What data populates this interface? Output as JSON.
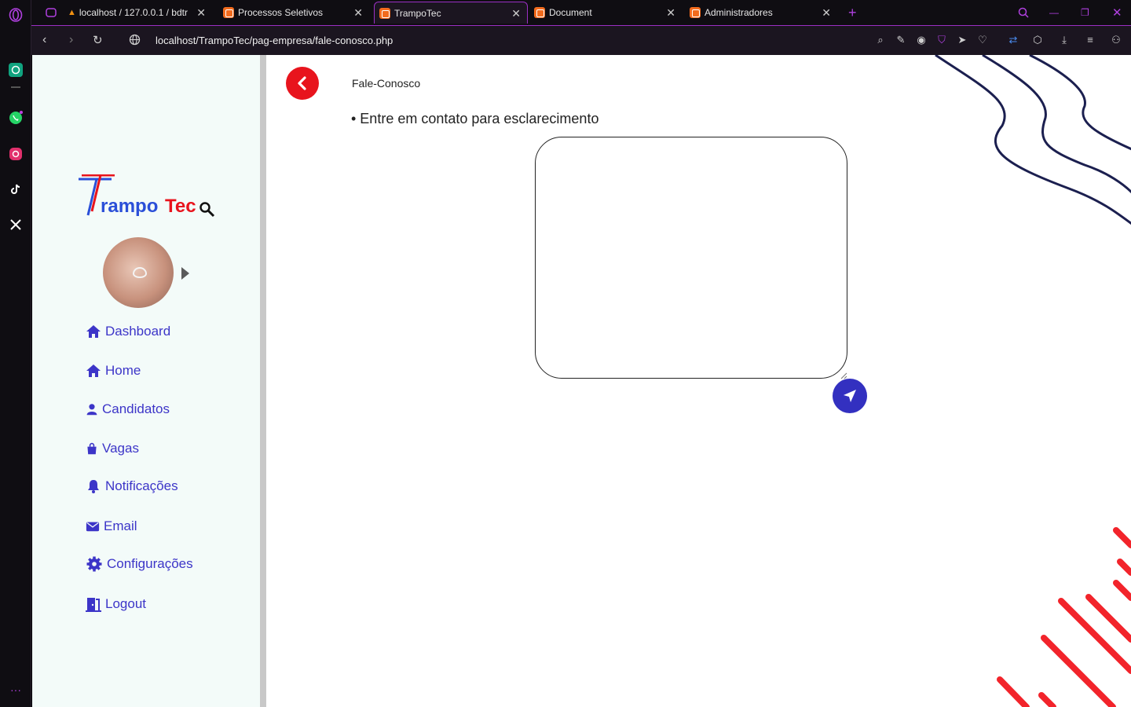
{
  "browser": {
    "tabs": [
      {
        "label": "localhost / 127.0.0.1 / bdtr"
      },
      {
        "label": "Processos Seletivos"
      },
      {
        "label": "TrampoTec"
      },
      {
        "label": "Document"
      },
      {
        "label": "Administradores"
      }
    ],
    "url": "localhost/TrampoTec/pag-empresa/fale-conosco.php"
  },
  "sidebar": {
    "logo_text": "TrampoTec",
    "items": [
      {
        "label": "Dashboard",
        "icon": "home-icon"
      },
      {
        "label": "Home",
        "icon": "home-icon"
      },
      {
        "label": "Candidatos",
        "icon": "user-icon"
      },
      {
        "label": "Vagas",
        "icon": "bag-icon"
      },
      {
        "label": "Notificações",
        "icon": "bell-icon"
      },
      {
        "label": "Email",
        "icon": "envelope-icon"
      },
      {
        "label": "Configurações",
        "icon": "gear-icon"
      },
      {
        "label": "Logout",
        "icon": "door-icon"
      }
    ]
  },
  "main": {
    "title": "Fale-Conosco",
    "subtitle": "• Entre em contato para esclarecimento",
    "message": {
      "value": "",
      "placeholder": ""
    }
  },
  "colors": {
    "accent": "#3c35c8",
    "back_button": "#e8141d",
    "send_button": "#3330c0",
    "sidebar_bg": "#f3fbf9",
    "deco_red": "#f2242b",
    "deco_navy": "#1b1f4f"
  }
}
